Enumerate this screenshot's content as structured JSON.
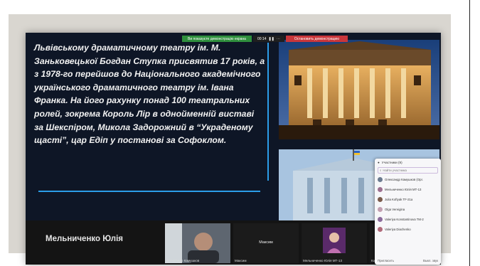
{
  "share_bar": {
    "status_text": "Ви показуєте демонстрацію екрана",
    "timer": "00:14",
    "stop_label": "Остановить демонстрацию"
  },
  "slide": {
    "text": "Львівському драматичному театру ім. М. Заньковецької Богдан Ступка присвятив 17 років, а з 1978-го перейшов до Національного академічного українського драматичного театру ім. Івана Франка. На його рахунку понад 100 театральних ролей, зокрема Король Лір в однойменній виставі за Шекспіром, Микола Задорожний в “Украденому щасті”, цар Едіп у постанові за Софоклом."
  },
  "participants_panel": {
    "title": "Участники (9)",
    "search_placeholder": "Найти участника",
    "list": [
      {
        "name": "Олександр Камушков (Орг.",
        "color": "#6b7a8f"
      },
      {
        "name": "Мельниченко Юлія МТ-13",
        "color": "#9c6f8f"
      },
      {
        "name": "Julia Koftyak TF-21a",
        "color": "#7a5a4a"
      },
      {
        "name": "Olga Vereigina",
        "color": "#c29fb0"
      },
      {
        "name": "Valeriya Konstantinova TM-2",
        "color": "#8a6a9a"
      },
      {
        "name": "Valeriya Diachenko",
        "color": "#b06a7a"
      }
    ],
    "invite_label": "Пригласить",
    "more_label": "Выкл. звук"
  },
  "video_strip": {
    "presenter_name": "Мельниченко Юлія",
    "tiles": [
      {
        "label": "Олександр Камушков"
      },
      {
        "label": "Максим",
        "center_name": "Максим"
      },
      {
        "label": "Мельниченко Юлія МТ-13"
      },
      {
        "label": "Ка"
      }
    ]
  }
}
